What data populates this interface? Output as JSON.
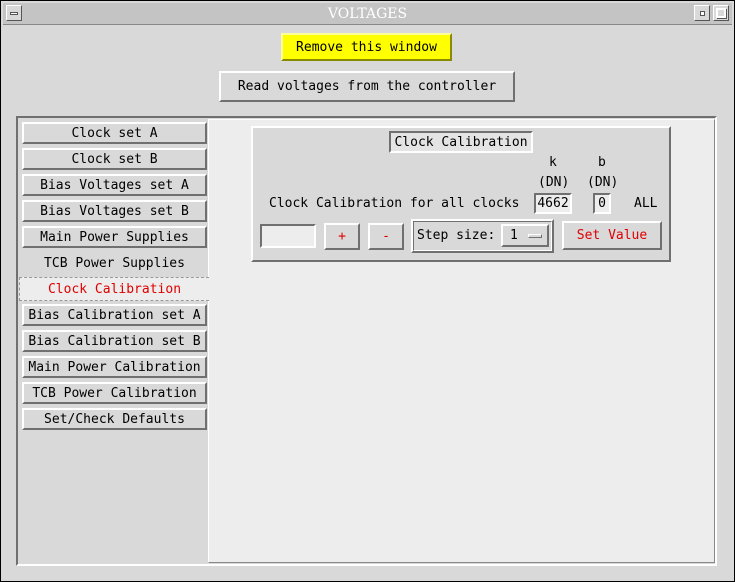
{
  "window": {
    "title": "VOLTAGES"
  },
  "actions": {
    "remove_label": "Remove this window",
    "read_label": "Read voltages from the controller"
  },
  "nav": {
    "items": [
      {
        "label": "Clock set A",
        "active": false
      },
      {
        "label": "Clock set B",
        "active": false
      },
      {
        "label": "Bias Voltages set A",
        "active": false
      },
      {
        "label": "Bias Voltages set B",
        "active": false
      },
      {
        "label": "Main Power Supplies",
        "active": false
      },
      {
        "label": "TCB Power Supplies",
        "active": false
      },
      {
        "label": "Clock Calibration",
        "active": true
      },
      {
        "label": "Bias Calibration set A",
        "active": false
      },
      {
        "label": "Bias Calibration set B",
        "active": false
      },
      {
        "label": "Main Power Calibration",
        "active": false
      },
      {
        "label": "TCB Power Calibration",
        "active": false
      },
      {
        "label": "Set/Check Defaults",
        "active": false
      }
    ]
  },
  "calibration": {
    "title": "Clock Calibration",
    "col_k": "k",
    "col_b": "b",
    "unit_k": "(DN)",
    "unit_b": "(DN)",
    "row_label": "Clock Calibration for all clocks",
    "k_value": "4662",
    "b_value": "0",
    "all_label": "ALL",
    "value_input": "",
    "plus_label": "+",
    "minus_label": "-",
    "step_label": "Step size:",
    "step_value": "1",
    "set_value_label": "Set Value"
  },
  "colors": {
    "active_text": "#e00000",
    "remove_bg": "#ffff00",
    "window_bg": "#d9d9d9"
  }
}
